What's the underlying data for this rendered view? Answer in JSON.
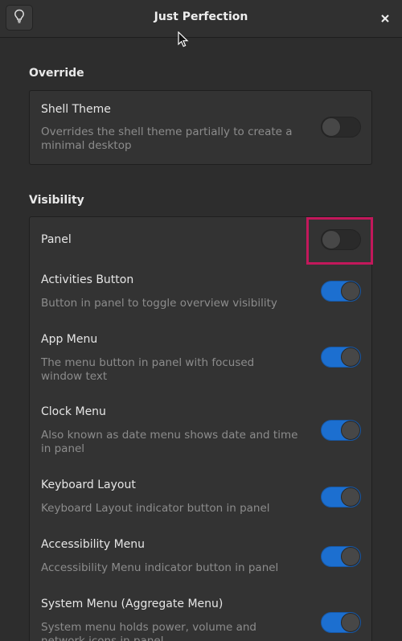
{
  "window": {
    "title": "Just Perfection",
    "header_button_icon": "lightbulb-icon",
    "close_icon": "close-icon"
  },
  "colors": {
    "accent": "#1c6fd0",
    "highlight": "#c2185b",
    "background": "#2d2d2d"
  },
  "override": {
    "section_title": "Override",
    "rows": [
      {
        "title": "Shell Theme",
        "subtitle": "Overrides the shell theme partially to create a minimal desktop",
        "enabled": false
      }
    ]
  },
  "visibility": {
    "section_title": "Visibility",
    "rows": [
      {
        "title": "Panel",
        "subtitle": "",
        "enabled": false
      },
      {
        "title": "Activities Button",
        "subtitle": "Button in panel to toggle overview visibility",
        "enabled": true
      },
      {
        "title": "App Menu",
        "subtitle": "The menu button in panel with focused window text",
        "enabled": true
      },
      {
        "title": "Clock Menu",
        "subtitle": "Also known as date menu shows date and time in panel",
        "enabled": true
      },
      {
        "title": "Keyboard Layout",
        "subtitle": "Keyboard Layout indicator button in panel",
        "enabled": true
      },
      {
        "title": "Accessibility Menu",
        "subtitle": "Accessibility Menu indicator button in panel",
        "enabled": true
      },
      {
        "title": "System Menu (Aggregate Menu)",
        "subtitle": "System menu holds power, volume and network icons in panel",
        "enabled": true
      }
    ]
  }
}
